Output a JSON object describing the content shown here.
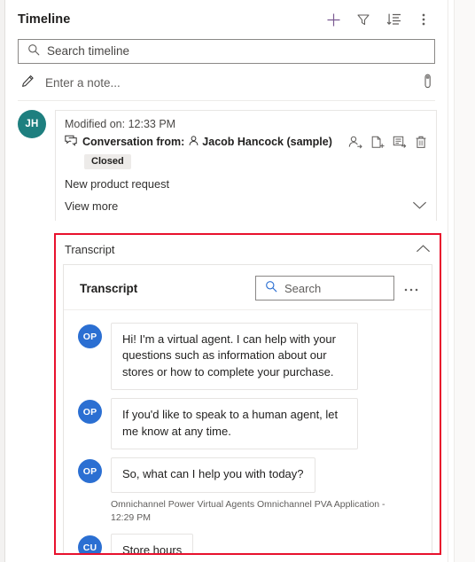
{
  "panel": {
    "title": "Timeline",
    "header_actions": [
      {
        "name": "add-icon",
        "tooltip": "Create a timeline record"
      },
      {
        "name": "filter-icon",
        "tooltip": "Filter"
      },
      {
        "name": "sort-descending-icon",
        "tooltip": "Sort"
      },
      {
        "name": "more-options-icon",
        "tooltip": "More commands"
      }
    ]
  },
  "search": {
    "placeholder": "Search timeline",
    "value": "",
    "icon": "search-icon"
  },
  "note": {
    "placeholder": "Enter a note...",
    "value": "",
    "pencil_icon": "pencil-icon",
    "attach_icon": "paperclip-icon"
  },
  "activity": {
    "avatar_initials": "JH",
    "avatar_color": "#1e7f7f",
    "modified_on": "Modified on: 12:33 PM",
    "conversation_label": "Conversation from:",
    "person": "Jacob Hancock (sample)",
    "conversation_icon": "chat-bubbles-icon",
    "person_icon": "contact-icon",
    "status_badge": "Closed",
    "subject": "New product request",
    "view_more": "View more",
    "view_more_icon": "chevron-down-icon",
    "actions": [
      {
        "name": "assign-icon",
        "tooltip": "Assign"
      },
      {
        "name": "convert-to-case-icon",
        "tooltip": "Convert to"
      },
      {
        "name": "add-to-queue-icon",
        "tooltip": "Add to queue"
      },
      {
        "name": "delete-icon",
        "tooltip": "Delete"
      }
    ]
  },
  "transcript_section": {
    "label": "Transcript",
    "collapse_icon": "chevron-up-icon",
    "highlight_color": "#e8112d"
  },
  "transcript_card": {
    "title": "Transcript",
    "search_placeholder": "Search",
    "search_value": "",
    "search_icon": "search-icon",
    "more_icon": "more-options-icon",
    "messages": [
      {
        "avatar_initials": "OP",
        "avatar_color": "#2b6fd2",
        "text": "Hi! I'm a virtual agent. I can help with your questions such as information about our stores or how to complete your purchase.",
        "meta": ""
      },
      {
        "avatar_initials": "OP",
        "avatar_color": "#2b6fd2",
        "text": "If you'd like to speak to a human agent, let me know at any time.",
        "meta": ""
      },
      {
        "avatar_initials": "OP",
        "avatar_color": "#2b6fd2",
        "text": "So, what can I help you with today?",
        "meta": "Omnichannel Power Virtual Agents Omnichannel PVA Application - 12:29 PM"
      },
      {
        "avatar_initials": "CU",
        "avatar_color": "#2b6fd2",
        "text": "Store hours",
        "meta": ""
      }
    ]
  }
}
